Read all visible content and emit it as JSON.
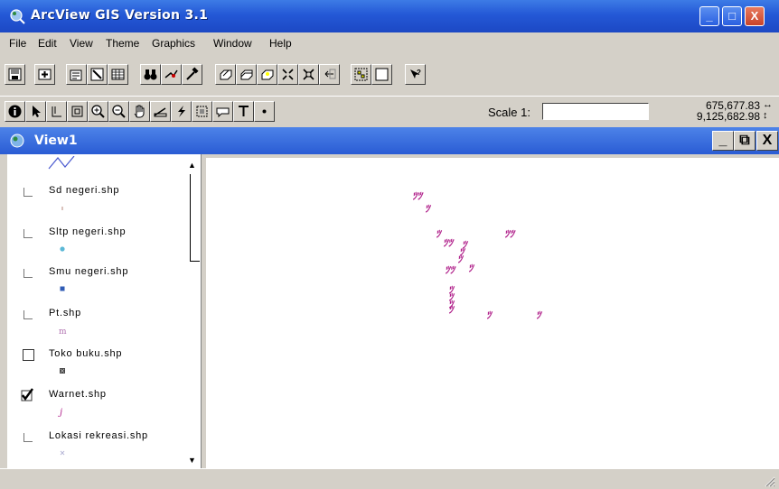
{
  "window": {
    "title": "ArcView GIS Version 3.1",
    "title_color": "#2458d6",
    "controls": {
      "minimize": "_",
      "maximize": "□",
      "close": "X"
    }
  },
  "menu": {
    "items": [
      {
        "label": "File"
      },
      {
        "label": "Edit"
      },
      {
        "label": "View"
      },
      {
        "label": "Theme"
      },
      {
        "label": "Graphics"
      },
      {
        "label": "Window"
      },
      {
        "label": "Help"
      }
    ]
  },
  "toolbar_buttons": {
    "row1": [
      "save-icon",
      "add-theme-icon",
      "theme-properties-icon",
      "edit-legend-icon",
      "open-table-icon",
      "find-icon",
      "locate-address-icon",
      "query-builder-icon",
      "zoom-to-full-extent-icon",
      "zoom-to-active-themes-icon",
      "zoom-to-selected-icon",
      "zoom-in-icon",
      "zoom-out-icon",
      "zoom-previous-icon",
      "select-features-icon",
      "clear-selection-icon",
      "help-icon"
    ],
    "row2": [
      "identify-icon",
      "pointer-icon",
      "vertex-edit-icon",
      "select-feature-icon",
      "zoom-in-tool-icon",
      "zoom-out-tool-icon",
      "pan-icon",
      "measure-icon",
      "hotlink-icon",
      "area-of-interest-icon",
      "label-icon",
      "text-icon",
      "draw-point-icon"
    ]
  },
  "scale": {
    "label": "Scale 1:",
    "value": ""
  },
  "coordinates": {
    "x": "675,677.83",
    "y": "9,125,682.98"
  },
  "view": {
    "title": "View1",
    "controls": {
      "minimize": "_",
      "restore": "⧉",
      "close": "X"
    }
  },
  "themes": [
    {
      "label": "Sd negeri.shp",
      "checked": false,
      "symbol": "dot-icon",
      "color": "#c9a7a0"
    },
    {
      "label": "Sltp negeri.shp",
      "checked": false,
      "symbol": "circle-icon",
      "color": "#5bb8d6"
    },
    {
      "label": "Smu negeri.shp",
      "checked": false,
      "symbol": "square-icon",
      "color": "#2f5bb5"
    },
    {
      "label": "Pt.shp",
      "checked": false,
      "symbol": "glyph-icon",
      "color": "#b070b0"
    },
    {
      "label": "Toko buku.shp",
      "checked": false,
      "symbol": "square-icon",
      "color": "#444444"
    },
    {
      "label": "Warnet.shp",
      "checked": true,
      "symbol": "glyph-icon",
      "color": "#b0208a"
    },
    {
      "label": "Lokasi rekreasi.shp",
      "checked": false,
      "symbol": "dot-icon",
      "color": "#b8b8d8"
    }
  ],
  "map_points_color": "#b0208a"
}
